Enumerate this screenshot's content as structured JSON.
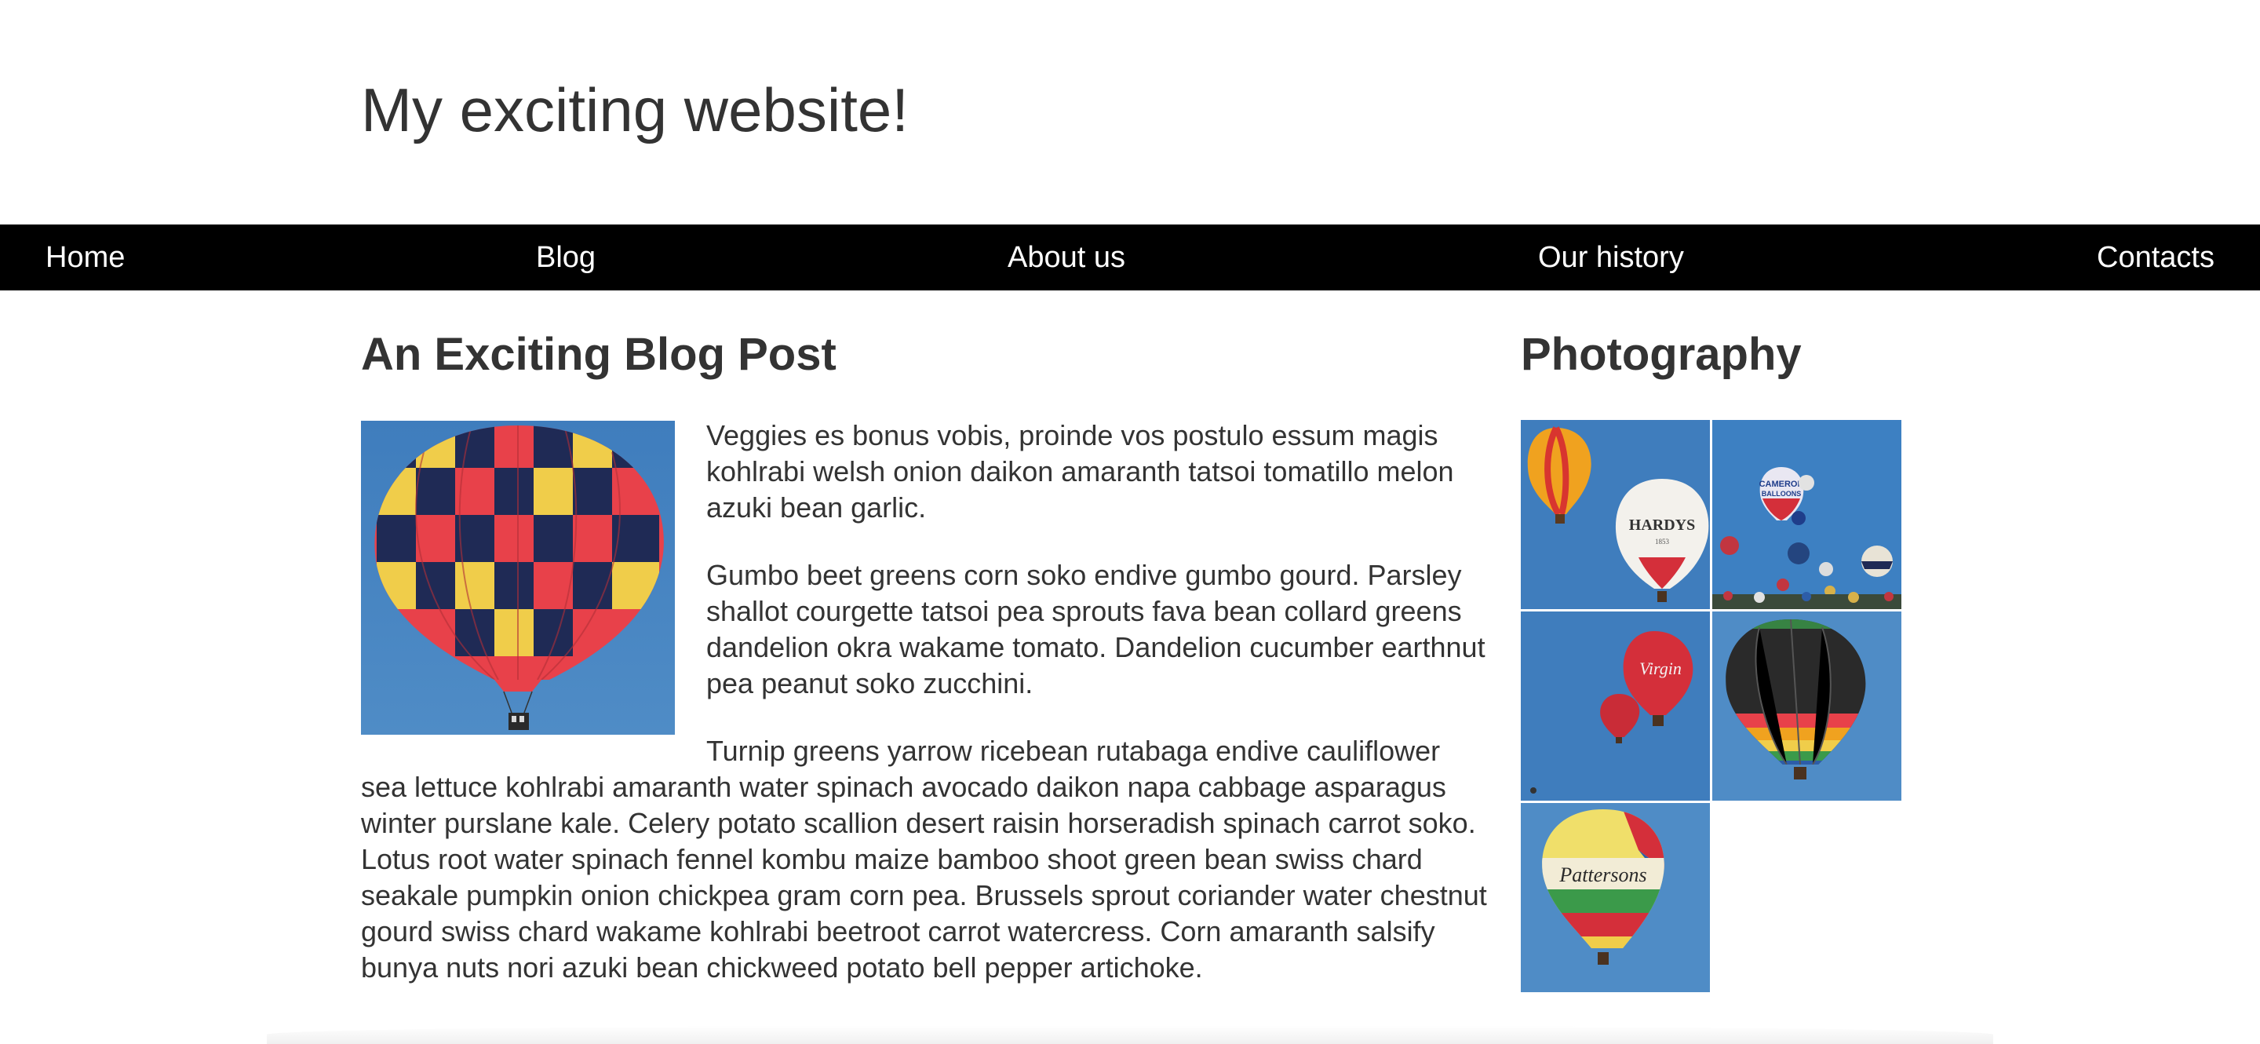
{
  "header": {
    "site_title": "My exciting website!"
  },
  "nav": {
    "items": [
      {
        "label": "Home"
      },
      {
        "label": "Blog"
      },
      {
        "label": "About us"
      },
      {
        "label": "Our history"
      },
      {
        "label": "Contacts"
      }
    ]
  },
  "post": {
    "title": "An Exciting Blog Post",
    "image_icon": "hot-air-balloon-photo",
    "paragraphs": [
      "Veggies es bonus vobis, proinde vos postulo essum magis kohlrabi welsh onion daikon amaranth tatsoi tomatillo melon azuki bean garlic.",
      "Gumbo beet greens corn soko endive gumbo gourd. Parsley shallot courgette tatsoi pea sprouts fava bean collard greens dandelion okra wakame tomato. Dandelion cucumber earthnut pea peanut soko zucchini.",
      "Turnip greens yarrow ricebean rutabaga endive cauliflower sea lettuce kohlrabi amaranth water spinach avocado daikon napa cabbage asparagus winter purslane kale. Celery potato scallion desert raisin horseradish spinach carrot soko. Lotus root water spinach fennel kombu maize bamboo shoot green bean swiss chard seakale pumpkin onion chickpea gram corn pea. Brussels sprout coriander water chestnut gourd swiss chard wakame kohlrabi beetroot carrot watercress. Corn amaranth salsify bunya nuts nori azuki bean chickweed potato bell pepper artichoke."
    ]
  },
  "sidebar": {
    "title": "Photography",
    "photos": [
      {
        "icon": "balloon-photo-1",
        "lettering": "HARDYS 1853"
      },
      {
        "icon": "balloon-photo-2",
        "lettering": "CAMERON BALLOONS"
      },
      {
        "icon": "balloon-photo-3",
        "lettering": "Virgin"
      },
      {
        "icon": "balloon-photo-4",
        "lettering": ""
      },
      {
        "icon": "balloon-photo-5",
        "lettering": "Pattersons"
      }
    ]
  },
  "colors": {
    "nav_background": "#000000",
    "nav_text": "#ffffff",
    "text": "#333333",
    "sky_blue": "#4a86c0"
  }
}
